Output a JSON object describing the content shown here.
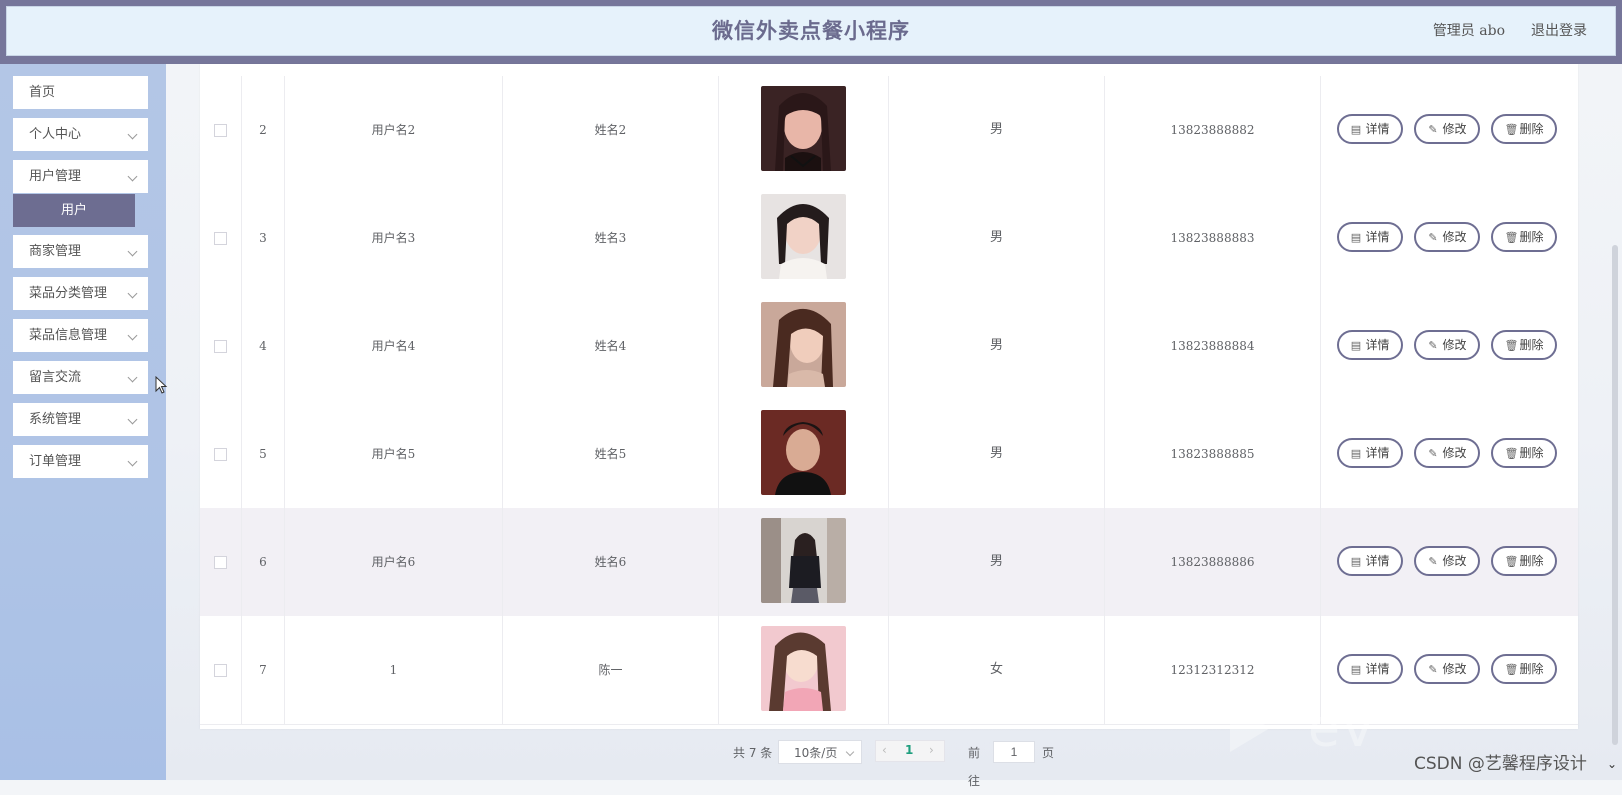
{
  "header": {
    "title": "微信外卖点餐小程序",
    "admin_label": "管理员 abo",
    "logout_label": "退出登录"
  },
  "sidebar": {
    "items": [
      {
        "label": "首页",
        "has_chevron": false
      },
      {
        "label": "个人中心",
        "has_chevron": true
      },
      {
        "label": "用户管理",
        "has_chevron": true
      },
      {
        "label": "商家管理",
        "has_chevron": true
      },
      {
        "label": "菜品分类管理",
        "has_chevron": true
      },
      {
        "label": "菜品信息管理",
        "has_chevron": true
      },
      {
        "label": "留言交流",
        "has_chevron": true
      },
      {
        "label": "系统管理",
        "has_chevron": true
      },
      {
        "label": "订单管理",
        "has_chevron": true
      }
    ],
    "active_submenu": "用户"
  },
  "table": {
    "rows": [
      {
        "index": "2",
        "username": "用户名2",
        "name": "姓名2",
        "gender": "男",
        "phone": "13823888882"
      },
      {
        "index": "3",
        "username": "用户名3",
        "name": "姓名3",
        "gender": "男",
        "phone": "13823888883"
      },
      {
        "index": "4",
        "username": "用户名4",
        "name": "姓名4",
        "gender": "男",
        "phone": "13823888884"
      },
      {
        "index": "5",
        "username": "用户名5",
        "name": "姓名5",
        "gender": "男",
        "phone": "13823888885"
      },
      {
        "index": "6",
        "username": "用户名6",
        "name": "姓名6",
        "gender": "男",
        "phone": "13823888886"
      },
      {
        "index": "7",
        "username": "1",
        "name": "陈一",
        "gender": "女",
        "phone": "12312312312"
      }
    ],
    "actions": {
      "detail": "详情",
      "edit": "修改",
      "delete": "删除"
    }
  },
  "pagination": {
    "total": "共 7 条",
    "page_size": "10条/页",
    "current_page": "1",
    "goto_label": "前往",
    "goto_value": "1",
    "page_unit": "页"
  },
  "watermark": {
    "csdn": "CSDN @艺馨程序设计"
  },
  "colors": {
    "header_border": "#76769a",
    "header_bg": "#e6f2fb",
    "sidebar_bg": "#b3c6e6",
    "accent": "#6d6d91",
    "page_active": "#1e9e7e"
  }
}
